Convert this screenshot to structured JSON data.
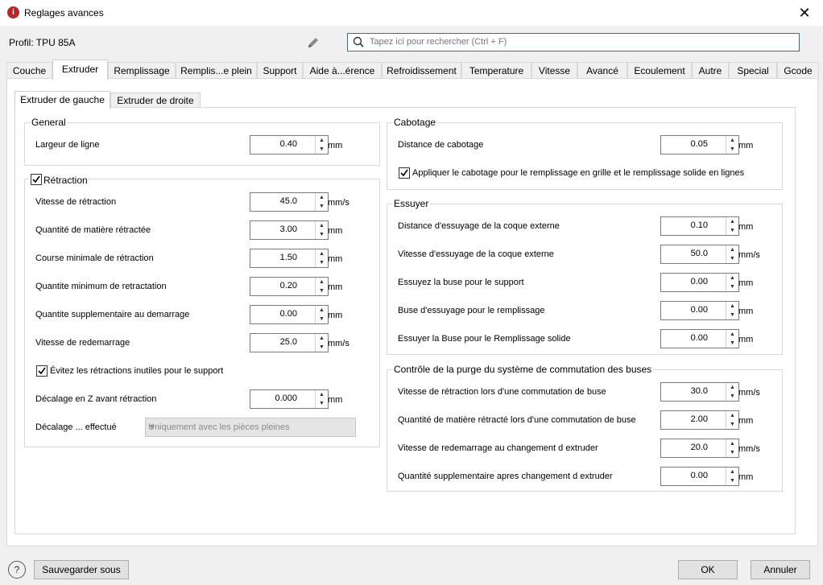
{
  "window": {
    "title": "Reglages avances",
    "close_glyph": "✕"
  },
  "profile": {
    "label": "Profil: TPU 85A"
  },
  "search": {
    "placeholder": "Tapez ici pour rechercher (Ctrl + F)"
  },
  "tabs": [
    {
      "label": "Couche"
    },
    {
      "label": "Extruder"
    },
    {
      "label": "Remplissage"
    },
    {
      "label": "Remplis...e plein"
    },
    {
      "label": "Support"
    },
    {
      "label": "Aide à...érence"
    },
    {
      "label": "Refroidissement"
    },
    {
      "label": "Temperature"
    },
    {
      "label": "Vitesse"
    },
    {
      "label": "Avancé"
    },
    {
      "label": "Ecoulement"
    },
    {
      "label": "Autre"
    },
    {
      "label": "Special"
    },
    {
      "label": "Gcode"
    }
  ],
  "active_tab": "Extruder",
  "subtabs": [
    {
      "label": "Extruder de gauche"
    },
    {
      "label": "Extruder de droite"
    }
  ],
  "active_subtab": "Extruder de gauche",
  "left": {
    "general": {
      "title": "General",
      "fields": [
        {
          "label": "Largeur de ligne",
          "value": "0.40",
          "unit": "mm"
        }
      ]
    },
    "retraction": {
      "title": "Rétraction",
      "checked": true,
      "fields": [
        {
          "label": "Vitesse de rétraction",
          "value": "45.0",
          "unit": "mm/s"
        },
        {
          "label": "Quantité de matière rétractée",
          "value": "3.00",
          "unit": "mm"
        },
        {
          "label": "Course minimale de rétraction",
          "value": "1.50",
          "unit": "mm"
        },
        {
          "label": "Quantite minimum de retractation",
          "value": "0.20",
          "unit": "mm"
        },
        {
          "label": "Quantite supplementaire au demarrage",
          "value": "0.00",
          "unit": "mm"
        },
        {
          "label": "Vitesse de redemarrage",
          "value": "25.0",
          "unit": "mm/s"
        }
      ],
      "avoid_checkbox": {
        "label": "Évitez les rétractions inutiles pour le support",
        "checked": true
      },
      "z_hop": {
        "label": "Décalage en Z avant rétraction",
        "value": "0.000",
        "unit": "mm"
      },
      "z_hop_when": {
        "label": "Décalage ... effectué",
        "value": "Uniquement avec les pièces pleines"
      }
    }
  },
  "right": {
    "coasting": {
      "title": "Cabotage",
      "fields": [
        {
          "label": "Distance de cabotage",
          "value": "0.05",
          "unit": "mm"
        }
      ],
      "checkbox": {
        "label": "Appliquer le cabotage pour le remplissage en grille et le remplissage solide en lignes",
        "checked": true
      }
    },
    "wipe": {
      "title": "Essuyer",
      "fields": [
        {
          "label": "Distance d'essuyage de la coque externe",
          "value": "0.10",
          "unit": "mm"
        },
        {
          "label": "Vitesse d'essuyage de la coque externe",
          "value": "50.0",
          "unit": "mm/s"
        },
        {
          "label": "Essuyez la buse pour le support",
          "value": "0.00",
          "unit": "mm"
        },
        {
          "label": "Buse d'essuyage pour le remplissage",
          "value": "0.00",
          "unit": "mm"
        },
        {
          "label": "Essuyer la Buse pour le Remplissage solide",
          "value": "0.00",
          "unit": "mm"
        }
      ]
    },
    "purge": {
      "title": "Contrôle de la purge du système de commutation des buses",
      "fields": [
        {
          "label": "Vitesse de rétraction lors d'une commutation de buse",
          "value": "30.0",
          "unit": "mm/s"
        },
        {
          "label": "Quantité de matière rétracté lors d'une commutation de buse",
          "value": "2.00",
          "unit": "mm"
        },
        {
          "label": "Vitesse de redemarrage au changement d extruder",
          "value": "20.0",
          "unit": "mm/s"
        },
        {
          "label": "Quantité supplementaire apres changement d extruder",
          "value": "0.00",
          "unit": "mm"
        }
      ]
    }
  },
  "footer": {
    "help_glyph": "?",
    "save_as": "Sauvegarder sous",
    "ok": "OK",
    "cancel": "Annuler"
  },
  "spin_up": "▲",
  "spin_down": "▼",
  "combo_arrow": "▼"
}
